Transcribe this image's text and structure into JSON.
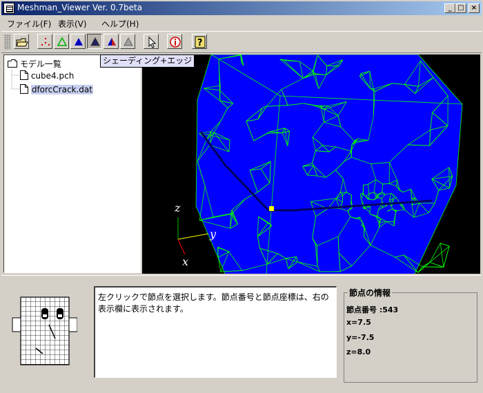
{
  "window": {
    "title": "Meshman_Viewer Ver. 0.7beta",
    "minimize": "_",
    "maximize": "□",
    "close": "×"
  },
  "menu": {
    "file": "ファイル(F)",
    "view": "表示(V)",
    "help": "ヘルプ(H)"
  },
  "toolbar": {
    "tooltip": "シェーディング+エッジ",
    "buttons": [
      "open-folder-icon",
      "node-points-icon",
      "wireframe-icon",
      "shading-icon",
      "shading-edge-icon",
      "color-shading-icon",
      "hidden-line-icon",
      "select-cursor-icon",
      "info-icon",
      "help-icon"
    ],
    "pressed": "shading-edge-icon"
  },
  "tree": {
    "root": "モデル一覧",
    "items": [
      "cube4.pch",
      "dforcCrack.dat"
    ],
    "selected_index": 1
  },
  "viewport": {
    "background": "#000000",
    "mesh_fill": "#0000ff",
    "mesh_edge": "#00ff00",
    "axes": {
      "z": "z",
      "y": "y",
      "x": "x"
    }
  },
  "message": "左クリックで節点を選択します。節点番号と節点座標は、右の表示欄に表示されます。",
  "node_info": {
    "legend": "節点の情報",
    "number": "節点番号 :543",
    "x": "x=7.5",
    "y": "y=-7.5",
    "z": "z=8.0"
  }
}
